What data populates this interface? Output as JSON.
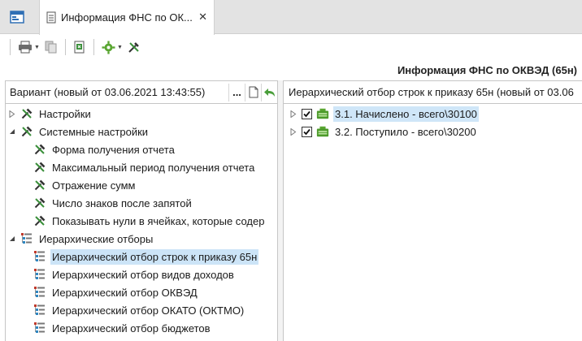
{
  "tabs": {
    "home_icon": "window-icon",
    "document_tab_label": "Информация ФНС по ОК...",
    "close_glyph": "✕"
  },
  "toolbar": {
    "buttons": [
      "print-icon",
      "copy-icon",
      "export-icon",
      "settings-gear-icon",
      "tools-icon"
    ]
  },
  "page": {
    "title": "Информация ФНС по ОКВЭД (65н)"
  },
  "left_panel": {
    "variant": "Вариант (новый от 03.06.2021 13:43:55)",
    "more_button": "...",
    "tree": [
      {
        "label": "Настройки",
        "level": 0,
        "expander": "collapsed",
        "icon": "tools-icon"
      },
      {
        "label": "Системные настройки",
        "level": 0,
        "expander": "expanded",
        "icon": "tools-icon"
      },
      {
        "label": "Форма получения отчета",
        "level": 1,
        "icon": "tools-icon"
      },
      {
        "label": "Максимальный период получения отчета",
        "level": 1,
        "icon": "tools-icon"
      },
      {
        "label": "Отражение сумм",
        "level": 1,
        "icon": "tools-icon"
      },
      {
        "label": "Число знаков после запятой",
        "level": 1,
        "icon": "tools-icon"
      },
      {
        "label": "Показывать нули в ячейках, которые содер",
        "level": 1,
        "icon": "tools-icon"
      },
      {
        "label": "Иерархические отборы",
        "level": 0,
        "expander": "expanded",
        "icon": "hierarchy-icon"
      },
      {
        "label": "Иерархический отбор строк к приказу 65н",
        "level": 1,
        "icon": "hierarchy-icon",
        "selected": true
      },
      {
        "label": "Иерархический отбор видов доходов",
        "level": 1,
        "icon": "hierarchy-icon"
      },
      {
        "label": "Иерархический отбор ОКВЭД",
        "level": 1,
        "icon": "hierarchy-icon"
      },
      {
        "label": "Иерархический отбор ОКАТО (ОКТМО)",
        "level": 1,
        "icon": "hierarchy-icon"
      },
      {
        "label": "Иерархический отбор бюджетов",
        "level": 1,
        "icon": "hierarchy-icon"
      }
    ]
  },
  "right_panel": {
    "header": "Иерархический отбор строк к приказу 65н (новый от 03.06",
    "tree": [
      {
        "label": "3.1. Начислено - всего\\30100",
        "checked": true,
        "highlighted": true
      },
      {
        "label": "3.2. Поступило - всего\\30200",
        "checked": true,
        "highlighted": false
      }
    ]
  },
  "colors": {
    "selection": "#cce4f7",
    "tab_strip": "#e3e3e3",
    "accent_green": "#4caf50"
  }
}
